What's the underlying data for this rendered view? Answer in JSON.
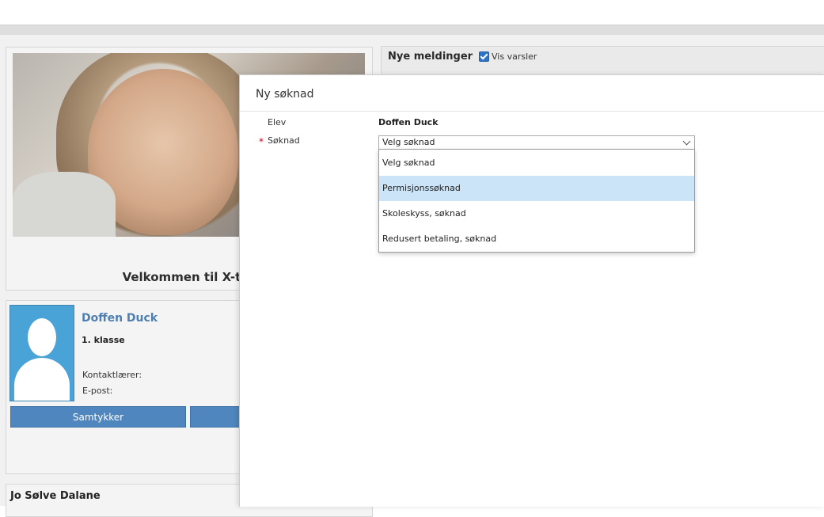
{
  "dashboard": {
    "welcome_text": "Velkommen til X-tes",
    "student": {
      "name": "Doffen Duck",
      "class": "1. klasse",
      "contact_teacher_label": "Kontaktlærer:",
      "email_label": "E-post:",
      "consent_button": "Samtykker"
    },
    "other_student_name": "Jo Sølve Dalane"
  },
  "messages": {
    "title": "Nye meldinger",
    "show_alerts_label": "Vis varsler",
    "show_alerts_checked": true
  },
  "dialog": {
    "title": "Ny søknad",
    "student_label": "Elev",
    "student_value": "Doffen Duck",
    "application_label": "Søknad",
    "required_marker": "*",
    "select_value": "Velg søknad",
    "options": [
      {
        "label": "Velg søknad"
      },
      {
        "label": "Permisjonssøknad"
      },
      {
        "label": "Skoleskyss, søknad"
      },
      {
        "label": "Redusert betaling, søknad"
      }
    ],
    "highlighted_option_index": 1
  },
  "colors": {
    "primary_button": "#4f86bd",
    "link_name": "#4d7fb0",
    "option_highlight": "#cce4f7",
    "required": "#d0021b"
  }
}
